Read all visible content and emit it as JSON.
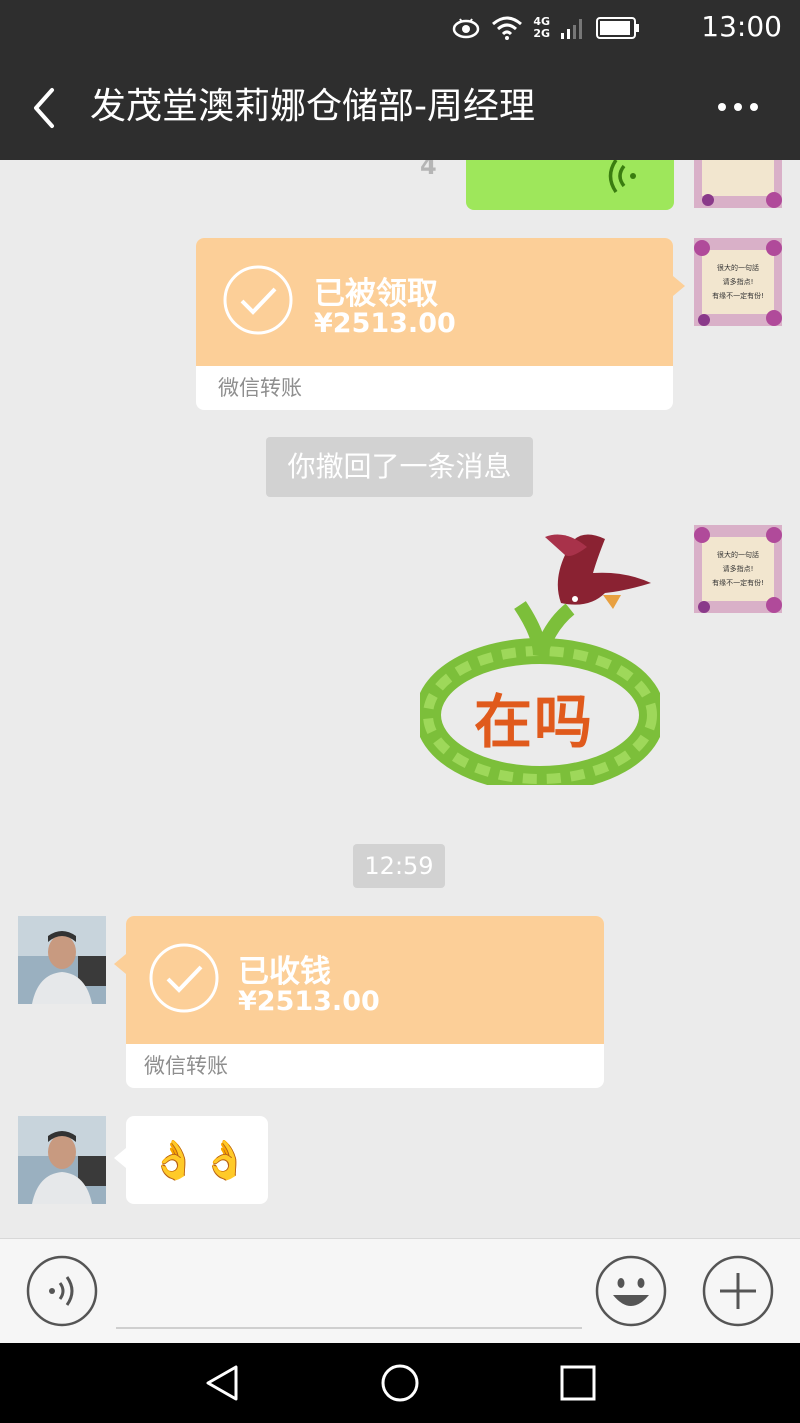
{
  "status_bar": {
    "time": "13:00",
    "icons": [
      "eye-icon",
      "wifi-icon",
      "signal-icon",
      "battery-icon"
    ],
    "network_top": "4G",
    "network_bottom": "2G"
  },
  "header": {
    "title": "发茂堂澳莉娜仓储部-周经理",
    "back_icon": "chevron-left-icon",
    "more_icon": "more-icon"
  },
  "messages": {
    "partial_digit": "4",
    "transfer_sent": {
      "status": "已被领取",
      "amount": "¥2513.00",
      "footer": "微信转账"
    },
    "recall_notice": "你撤回了一条消息",
    "sticker": {
      "text": "在吗"
    },
    "timestamp": "12:59",
    "transfer_received": {
      "status": "已收钱",
      "amount": "¥2513.00",
      "footer": "微信转账"
    },
    "ok_emoji": "👌👌"
  },
  "avatar_card": {
    "line1": "很大的一句話",
    "line2": "请多指点!",
    "line3": "有缘不一定有份!"
  },
  "input_bar": {
    "voice_icon": "voice-icon",
    "emoji_icon": "emoji-icon",
    "plus_icon": "plus-icon",
    "placeholder": ""
  },
  "nav_bar": {
    "icons": [
      "nav-back-icon",
      "nav-home-icon",
      "nav-recent-icon"
    ]
  },
  "colors": {
    "header_bg": "#2e2e2e",
    "chat_bg": "#ebebeb",
    "transfer_orange": "#fccf98",
    "sent_green": "#9ee75b"
  }
}
